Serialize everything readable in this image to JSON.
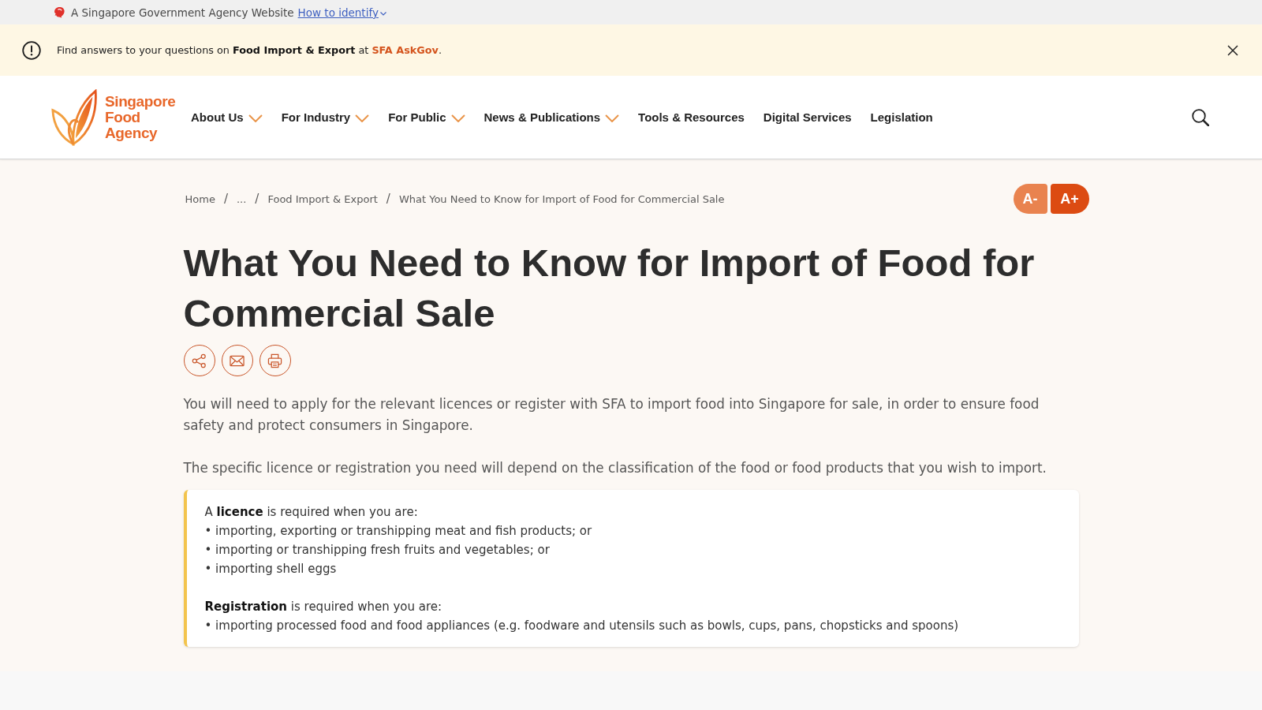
{
  "gov_bar": {
    "text": "A Singapore Government Agency Website",
    "link": "How to identify"
  },
  "notice": {
    "text": "Find answers to your questions on **Food Import & Export** at ",
    "link": "SFA AskGov",
    "end": "."
  },
  "header": {
    "logo": [
      "Singapore",
      "Food",
      "Agency"
    ],
    "nav": [
      {
        "label": "About Us",
        "has_menu": true
      },
      {
        "label": "For Industry",
        "has_menu": true
      },
      {
        "label": "For Public",
        "has_menu": true
      },
      {
        "label": "News & Publications",
        "has_menu": true
      },
      {
        "label": "Tools & Resources",
        "has_menu": false
      },
      {
        "label": "Digital Services",
        "has_menu": false
      },
      {
        "label": "Legislation",
        "has_menu": false
      }
    ]
  },
  "breadcrumb": [
    {
      "label": "Home",
      "separator": "/"
    },
    {
      "label": "...",
      "separator": "/"
    },
    {
      "label": "Food Import & Export",
      "separator": "/"
    },
    {
      "label": "What You Need to Know for Import of Food for Commercial Sale"
    }
  ],
  "text_size": [
    {
      "label": "A-",
      "kind": "decrease"
    },
    {
      "label": "A+",
      "kind": "increase"
    }
  ],
  "title": "What You Need to Know for Import of Food for Commercial Sale",
  "intro": [
    "You will need to apply for the relevant licences or register with SFA to import food into Singapore for sale, in order to ensure food safety and protect consumers in Singapore.",
    "The specific licence or registration you need will depend on the classification of the food or food products that you wish to import."
  ],
  "callout": [
    {
      "heading": "A **licence** is required when you are:",
      "items": [
        "• importing, exporting or transhipping meat and fish products; or",
        "• importing or transhipping fresh fruits and vegetables; or",
        "• importing shell eggs"
      ]
    },
    {
      "heading": "**Registration** is required when you are:",
      "items": [
        "• importing processed food and food appliances (e.g. foodware and utensils such as bowls, cups, pans, chopsticks and spoons)"
      ]
    }
  ]
}
